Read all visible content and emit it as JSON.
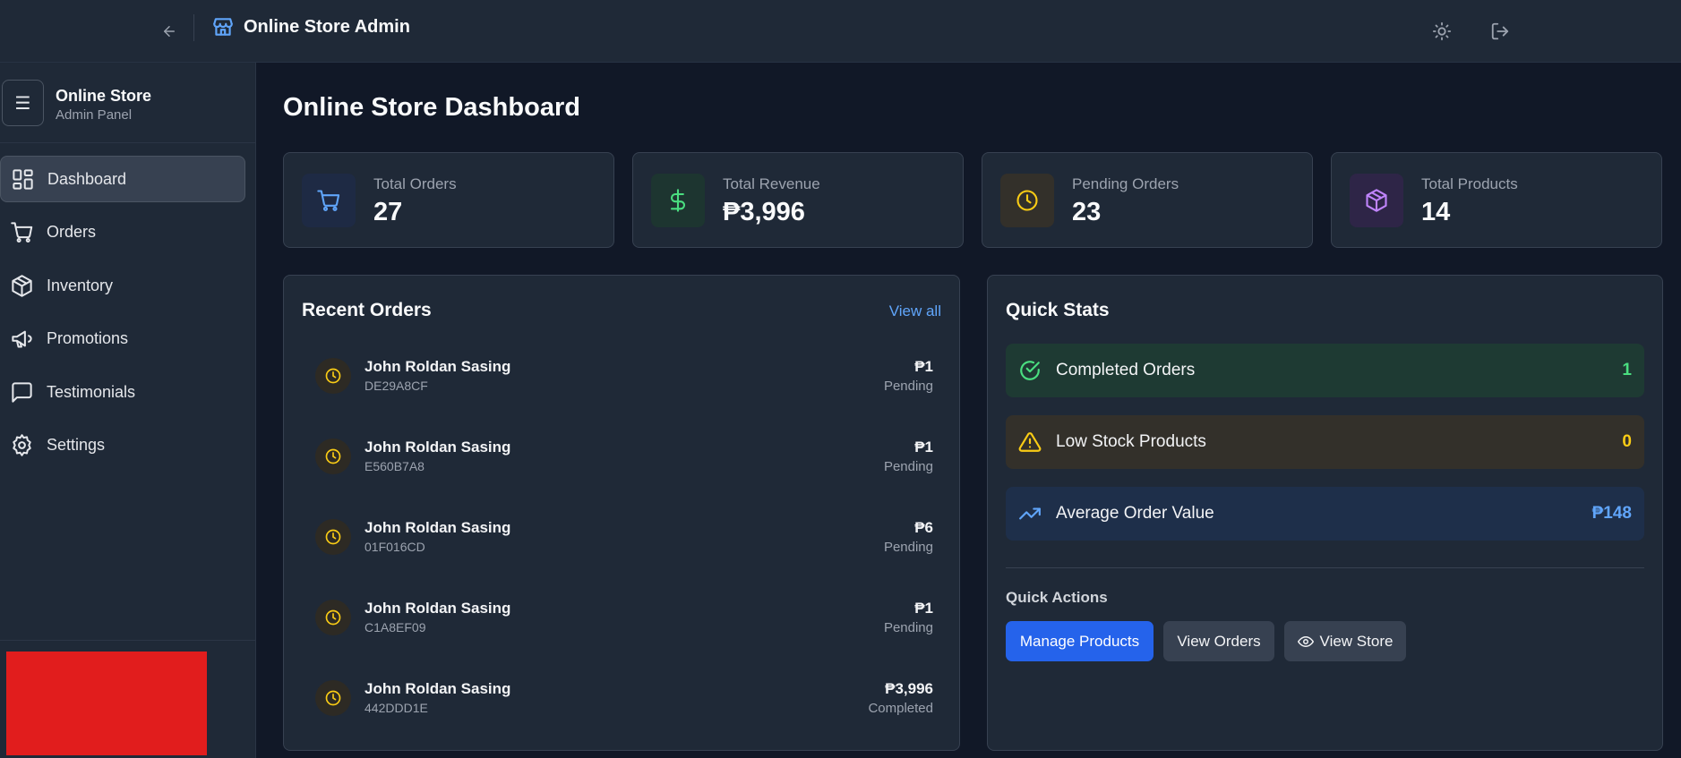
{
  "topbar": {
    "title": "Online Store Admin",
    "icons": {
      "back": "arrow-left-icon",
      "brand": "store-icon",
      "theme": "sun-icon",
      "logout": "logout-icon"
    }
  },
  "sidebar": {
    "title": "Online Store",
    "subtitle": "Admin Panel",
    "menu_glyph": "☰",
    "items": [
      {
        "label": "Dashboard",
        "icon": "dashboard-icon",
        "active": true
      },
      {
        "label": "Orders",
        "icon": "cart-icon",
        "active": false
      },
      {
        "label": "Inventory",
        "icon": "box-icon",
        "active": false
      },
      {
        "label": "Promotions",
        "icon": "megaphone-icon",
        "active": false
      },
      {
        "label": "Testimonials",
        "icon": "message-icon",
        "active": false
      },
      {
        "label": "Settings",
        "icon": "gear-icon",
        "active": false
      }
    ]
  },
  "main": {
    "page_title": "Online Store Dashboard",
    "stats": [
      {
        "label": "Total Orders",
        "value": "27",
        "icon": "cart-icon",
        "color": "#60a5fa"
      },
      {
        "label": "Total Revenue",
        "value": "₱3,996",
        "icon": "dollar-icon",
        "color": "#4ade80"
      },
      {
        "label": "Pending Orders",
        "value": "23",
        "icon": "clock-icon",
        "color": "#facc15"
      },
      {
        "label": "Total Products",
        "value": "14",
        "icon": "box-icon",
        "color": "#c084fc"
      }
    ],
    "recent_orders": {
      "title": "Recent Orders",
      "view_all": "View all",
      "rows": [
        {
          "name": "John Roldan Sasing",
          "id": "DE29A8CF",
          "amount": "₱1",
          "status": "Pending"
        },
        {
          "name": "John Roldan Sasing",
          "id": "E560B7A8",
          "amount": "₱1",
          "status": "Pending"
        },
        {
          "name": "John Roldan Sasing",
          "id": "01F016CD",
          "amount": "₱6",
          "status": "Pending"
        },
        {
          "name": "John Roldan Sasing",
          "id": "C1A8EF09",
          "amount": "₱1",
          "status": "Pending"
        },
        {
          "name": "John Roldan Sasing",
          "id": "442DDD1E",
          "amount": "₱3,996",
          "status": "Completed"
        }
      ]
    },
    "quick_stats": {
      "title": "Quick Stats",
      "rows": [
        {
          "label": "Completed Orders",
          "value": "1",
          "icon": "check-circle-icon",
          "color": "#4ade80",
          "bg": "#1e3a33"
        },
        {
          "label": "Low Stock Products",
          "value": "0",
          "icon": "warning-icon",
          "color": "#facc15",
          "bg": "#33302a"
        },
        {
          "label": "Average Order Value",
          "value": "₱148",
          "icon": "trending-up-icon",
          "color": "#60a5fa",
          "bg": "#1e2f4a"
        }
      ],
      "actions_label": "Quick Actions",
      "actions": {
        "manage_products": "Manage Products",
        "view_orders": "View Orders",
        "view_store": "View Store"
      }
    }
  }
}
